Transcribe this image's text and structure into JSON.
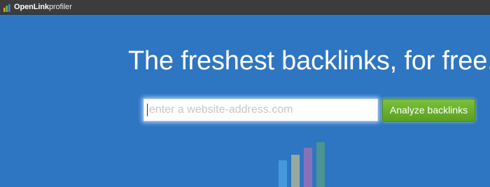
{
  "header": {
    "logo_bold": "OpenLink",
    "logo_light": "profiler"
  },
  "hero": {
    "headline": "The freshest backlinks, for free.",
    "search": {
      "placeholder": "enter a website-address.com",
      "value": ""
    },
    "analyze_button_label": "Analyze backlinks"
  },
  "colors": {
    "topbar": "#3c3c3c",
    "hero_background": "#2e76c2",
    "button_green": "#6ab22e",
    "logo_bars": [
      "#e5a323",
      "#7fb93f",
      "#3f8fd0"
    ],
    "decor_bars": [
      "#4a9fe0",
      "#a8b39a",
      "#9a6fb8",
      "#4f9a8a"
    ]
  },
  "icons": {
    "logo": "bar-chart-icon",
    "decoration": "bar-chart-icon"
  }
}
